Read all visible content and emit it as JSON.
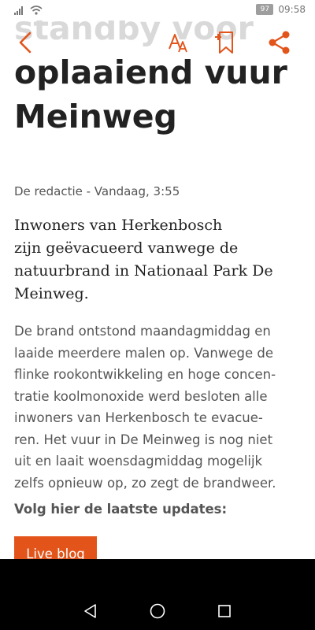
{
  "status_bar": {
    "battery": "97",
    "time": "09:58"
  },
  "toolbar": {
    "back_icon": "chevron-left-icon",
    "font_icon": "font-size-icon",
    "bookmark_icon": "bookmark-add-icon",
    "share_icon": "share-icon",
    "accent_color": "#e2541a"
  },
  "article": {
    "headline_lines": [
      "standby voor",
      "oplaaiend vuur",
      "Meinweg"
    ],
    "byline": "De redactie - Vandaag, 3:55",
    "intro_lines": [
      "Inwoners van Herkenbosch",
      "zijn geëvacueerd vanwege de",
      "natuurbrand in Nationaal Park De",
      "Meinweg."
    ],
    "body_lines": [
      "De brand ontstond maandagmiddag en",
      "laaide meerdere malen op. Vanwege de",
      "flinke rookontwikkeling en hoge concen-",
      "tratie koolmonoxide werd besloten alle",
      "inwoners van Herkenbosch te evacue-",
      "ren. Het vuur in De Meinweg is nog niet",
      "uit en laait woensdagmiddag mogelijk",
      "zelfs opnieuw op, zo zegt de brandweer."
    ],
    "updates_label": "Volg hier de laatste updates:",
    "live_blog_label": "Live blog"
  },
  "nav_bar": {
    "back_icon": "triangle-back-icon",
    "home_icon": "circle-home-icon",
    "recent_icon": "square-recent-icon"
  }
}
